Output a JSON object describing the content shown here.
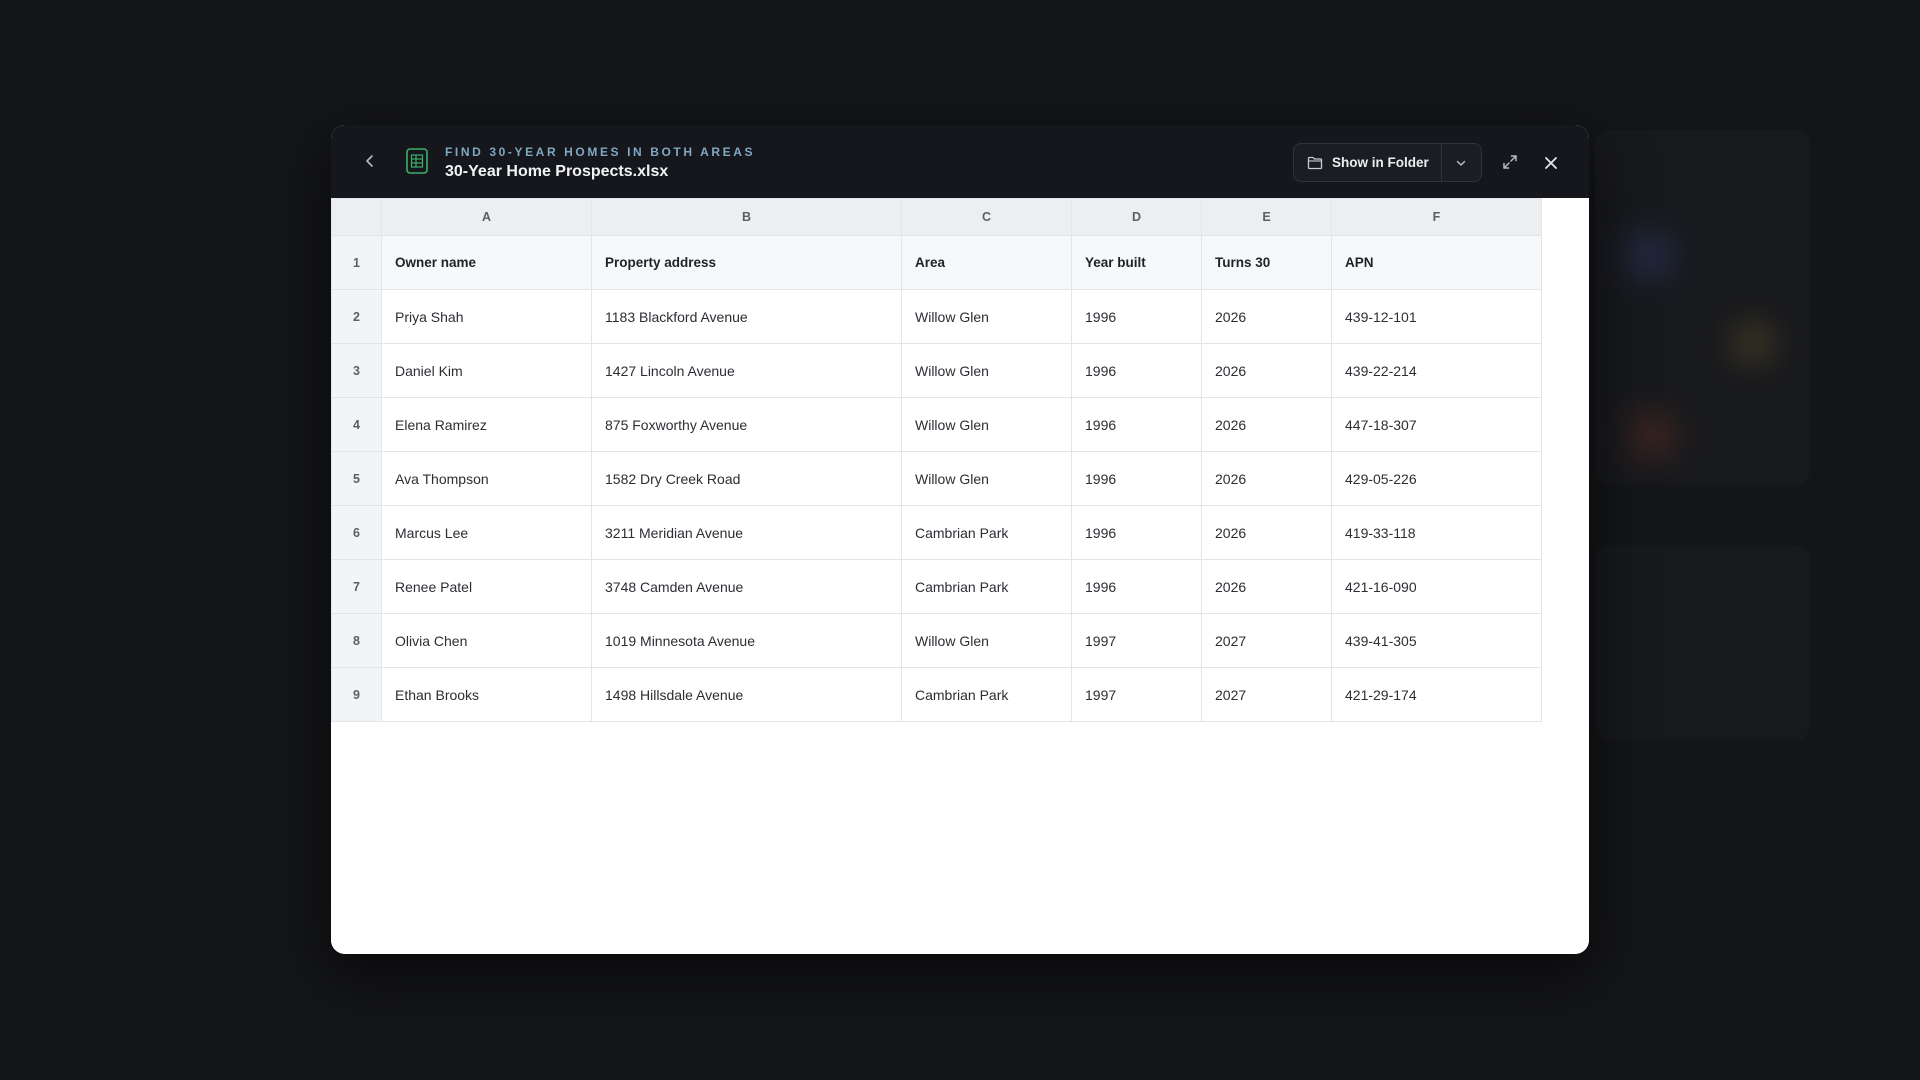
{
  "header": {
    "kicker": "FIND 30-YEAR HOMES IN BOTH AREAS",
    "filename": "30-Year Home Prospects.xlsx",
    "show_in_folder_label": "Show in Folder"
  },
  "icons": {
    "back": "chevron-left-icon",
    "file": "spreadsheet-icon",
    "folder": "folder-icon",
    "dropdown": "chevron-down-icon",
    "expand": "expand-icon",
    "close": "close-icon"
  },
  "sheet": {
    "columns": [
      "A",
      "B",
      "C",
      "D",
      "E",
      "F"
    ],
    "rows": [
      {
        "num": "1",
        "cells": [
          "Owner name",
          "Property address",
          "Area",
          "Year built",
          "Turns 30",
          "APN"
        ]
      },
      {
        "num": "2",
        "cells": [
          "Priya Shah",
          "1183 Blackford Avenue",
          "Willow Glen",
          "1996",
          "2026",
          "439-12-101"
        ]
      },
      {
        "num": "3",
        "cells": [
          "Daniel Kim",
          "1427 Lincoln Avenue",
          "Willow Glen",
          "1996",
          "2026",
          "439-22-214"
        ]
      },
      {
        "num": "4",
        "cells": [
          "Elena Ramirez",
          "875 Foxworthy Avenue",
          "Willow Glen",
          "1996",
          "2026",
          "447-18-307"
        ]
      },
      {
        "num": "5",
        "cells": [
          "Ava Thompson",
          "1582 Dry Creek Road",
          "Willow Glen",
          "1996",
          "2026",
          "429-05-226"
        ]
      },
      {
        "num": "6",
        "cells": [
          "Marcus Lee",
          "3211 Meridian Avenue",
          "Cambrian Park",
          "1996",
          "2026",
          "419-33-118"
        ]
      },
      {
        "num": "7",
        "cells": [
          "Renee Patel",
          "3748 Camden Avenue",
          "Cambrian Park",
          "1996",
          "2026",
          "421-16-090"
        ]
      },
      {
        "num": "8",
        "cells": [
          "Olivia Chen",
          "1019 Minnesota Avenue",
          "Willow Glen",
          "1997",
          "2027",
          "439-41-305"
        ]
      },
      {
        "num": "9",
        "cells": [
          "Ethan Brooks",
          "1498 Hillsdale Avenue",
          "Cambrian Park",
          "1997",
          "2027",
          "421-29-174"
        ]
      }
    ]
  },
  "colors": {
    "header_bg": "#15171c",
    "kicker": "#7fa8c2",
    "file_icon": "#3fae6a"
  }
}
